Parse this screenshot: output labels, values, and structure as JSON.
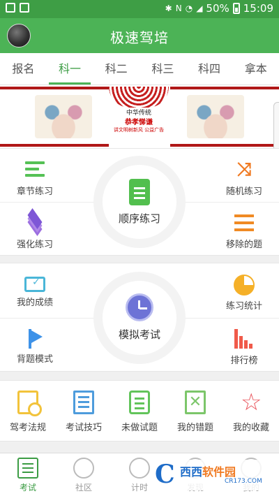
{
  "status_bar": {
    "battery": "50%",
    "time": "15:09"
  },
  "header": {
    "title": "极速驾培"
  },
  "tabs": [
    "报名",
    "科一",
    "科二",
    "科三",
    "科四",
    "拿本"
  ],
  "active_tab": "科一",
  "banner": {
    "line1": "中华传统",
    "line2": "孝悌谦",
    "line2_highlight": "恭",
    "line3": "讲文明树新风 公益广告"
  },
  "practice_panel": {
    "top_left": "章节练习",
    "top_right": "随机练习",
    "bottom_left": "强化练习",
    "bottom_right": "移除的题",
    "center": "顺序练习"
  },
  "exam_panel": {
    "top_left": "我的成绩",
    "top_right": "练习统计",
    "bottom_left": "背题模式",
    "bottom_right": "排行榜",
    "center": "模拟考试"
  },
  "shortcuts": [
    "驾考法规",
    "考试技巧",
    "未做试题",
    "我的错题",
    "我的收藏"
  ],
  "bottom_nav": [
    "考试",
    "社区",
    "计时",
    "发现",
    "我的"
  ],
  "watermark": {
    "brand_a": "西西",
    "brand_b": "软件园",
    "url": "CR173.COM"
  },
  "colors": {
    "primary": "#4cb356",
    "orange": "#f07a22",
    "purple": "#6d73d6"
  }
}
